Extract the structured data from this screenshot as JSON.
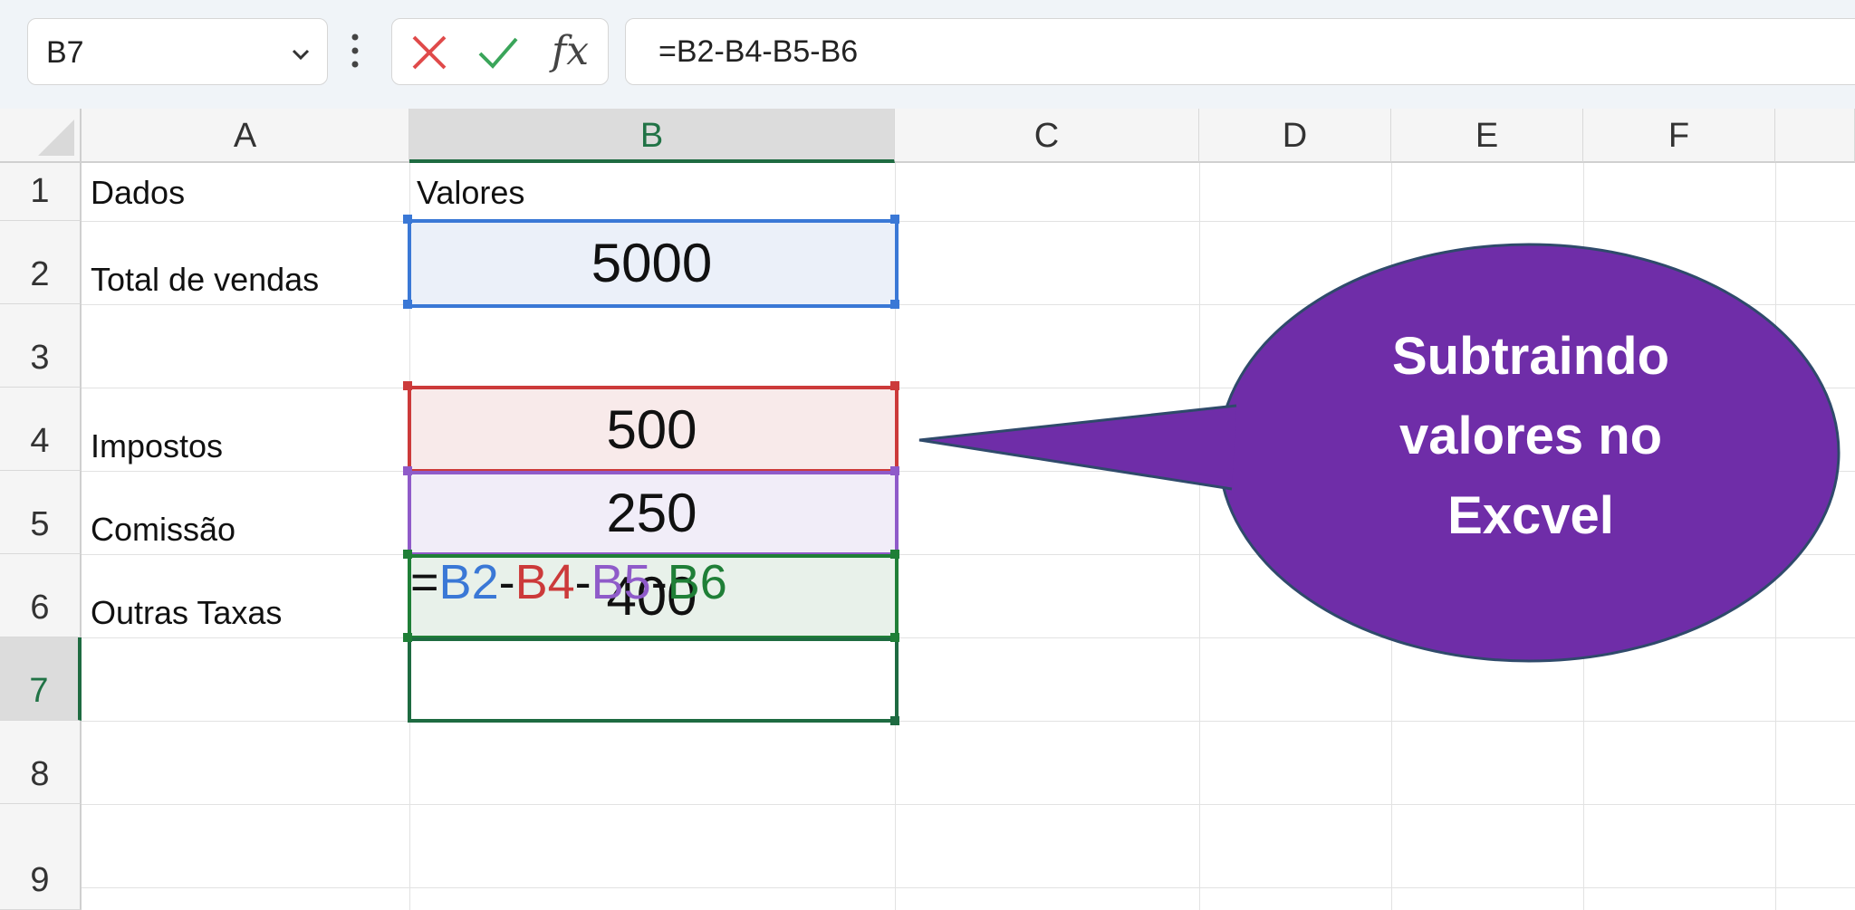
{
  "formula_bar": {
    "name_box": "B7",
    "formula": "=B2-B4-B5-B6"
  },
  "columns": [
    "A",
    "B",
    "C",
    "D",
    "E",
    "F"
  ],
  "rows": [
    "1",
    "2",
    "3",
    "4",
    "5",
    "6",
    "7",
    "8",
    "9"
  ],
  "cells": {
    "A1": "Dados",
    "B1": "Valores",
    "A2": "Total de vendas",
    "B2": "5000",
    "A4": "Impostos",
    "B4": "500",
    "A5": "Comissão",
    "B5": "250",
    "A6": "Outras Taxas",
    "B6": "400"
  },
  "formula_cell": {
    "eq": "=",
    "refs": [
      {
        "ref": "B2",
        "color": "#3a78d6"
      },
      {
        "ref": "B4",
        "color": "#cc3a3a"
      },
      {
        "ref": "B5",
        "color": "#8f5bc9"
      },
      {
        "ref": "B6",
        "color": "#1f7f37"
      }
    ],
    "op": "-"
  },
  "callout": {
    "text_lines": [
      "Subtraindo",
      "valores no",
      "Excvel"
    ],
    "color": "#6f2da8"
  }
}
